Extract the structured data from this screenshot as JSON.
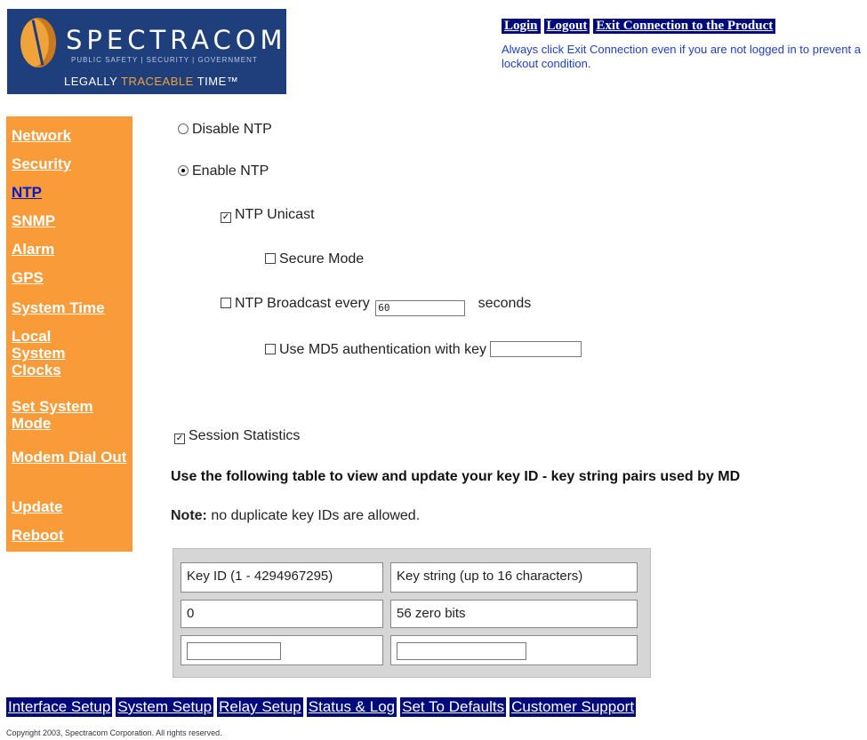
{
  "logo": {
    "brand": "SPECTRACOM",
    "tagline": "PUBLIC SAFETY | SECURITY | GOVERNMENT",
    "trace_pre": "LEGALLY ",
    "trace_hl": "TRACEABLE",
    "trace_post": " TIME™"
  },
  "toplinks": {
    "login": "Login",
    "logout": "Logout",
    "exit": "Exit Connection to the Product",
    "notice": "Always click Exit Connection even if you are not logged in to prevent a lockout condition."
  },
  "sidebar": {
    "items": [
      {
        "label": "Network"
      },
      {
        "label": "Security"
      },
      {
        "label": "NTP"
      },
      {
        "label": "SNMP"
      },
      {
        "label": "Alarm"
      },
      {
        "label": "GPS"
      },
      {
        "label": "System Time"
      },
      {
        "label": "Local System Clocks"
      },
      {
        "label": "Set System Mode"
      },
      {
        "label": "Modem Dial Out"
      },
      {
        "label": "Update"
      },
      {
        "label": "Reboot"
      }
    ],
    "active": "NTP"
  },
  "ntp": {
    "disable_label": "Disable NTP",
    "enable_label": "Enable NTP",
    "selected": "enable",
    "unicast_label": "NTP Unicast",
    "unicast_checked": true,
    "secure_label": "Secure Mode",
    "secure_checked": false,
    "broadcast_label": "NTP Broadcast every",
    "broadcast_checked": false,
    "broadcast_value": "60",
    "broadcast_unit": "seconds",
    "md5_label": "Use MD5 authentication with key",
    "md5_checked": false,
    "md5_value": "",
    "session_label": "Session Statistics",
    "session_checked": true
  },
  "heading": "Use the following table to view and update your key ID - key string pairs used by MD",
  "note": {
    "bold": "Note:",
    "text": " no duplicate key IDs are allowed."
  },
  "key_table": {
    "headers": [
      "Key ID (1 - 4294967295)",
      "Key string (up to 16 characters)"
    ],
    "rows": [
      [
        "0",
        "56 zero bits"
      ]
    ],
    "new_row": [
      "",
      ""
    ]
  },
  "bottomnav": {
    "items": [
      {
        "label": "Interface Setup"
      },
      {
        "label": "System Setup"
      },
      {
        "label": "Relay Setup"
      },
      {
        "label": "Status & Log"
      },
      {
        "label": "Set To Defaults"
      },
      {
        "label": "Customer Support"
      }
    ]
  },
  "copyright": "Copyright 2003, Spectracom Corporation. All rights reserved."
}
